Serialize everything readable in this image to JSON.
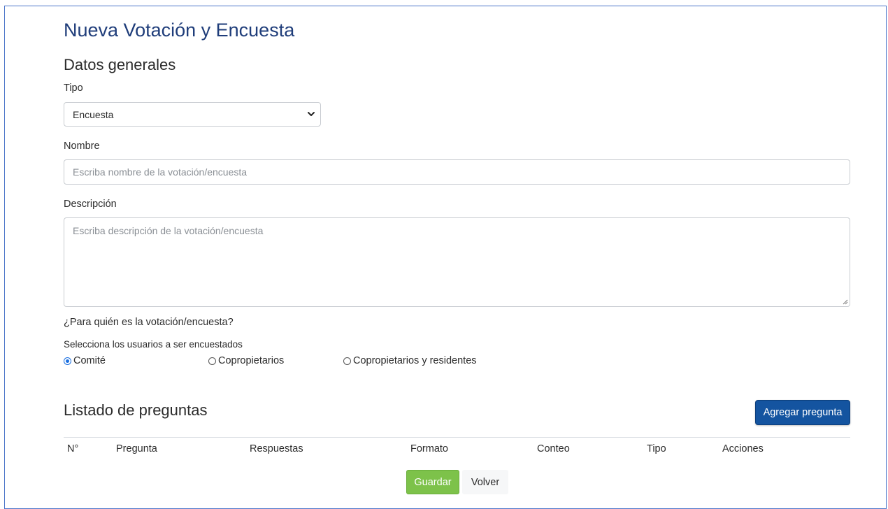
{
  "page": {
    "title": "Nueva Votación y Encuesta",
    "section_general": "Datos generales",
    "section_questions": "Listado de preguntas"
  },
  "form": {
    "tipo": {
      "label": "Tipo",
      "selected": "Encuesta"
    },
    "nombre": {
      "label": "Nombre",
      "placeholder": "Escriba nombre de la votación/encuesta"
    },
    "descripcion": {
      "label": "Descripción",
      "placeholder": "Escriba descripción de la votación/encuesta"
    },
    "audience": {
      "question": "¿Para quién es la votación/encuesta?",
      "helper": "Selecciona los usuarios a ser encuestados",
      "options": [
        {
          "label": "Comité",
          "checked": true
        },
        {
          "label": "Copropietarios",
          "checked": false
        },
        {
          "label": "Copropietarios y residentes",
          "checked": false
        }
      ]
    }
  },
  "questions": {
    "add_button": "Agregar pregunta",
    "columns": [
      "N°",
      "Pregunta",
      "Respuestas",
      "Formato",
      "Conteo",
      "Tipo",
      "Acciones"
    ]
  },
  "footer": {
    "save": "Guardar",
    "back": "Volver"
  },
  "colors": {
    "title": "#1f3d7a",
    "primary": "#1454a0",
    "success": "#7dc24a",
    "radio_accent": "#1a6fe0",
    "frame_border": "#4a74c9"
  },
  "icons": {
    "select_chevron": "chevron-down-icon",
    "resize_grip": "resize-grip-icon"
  }
}
